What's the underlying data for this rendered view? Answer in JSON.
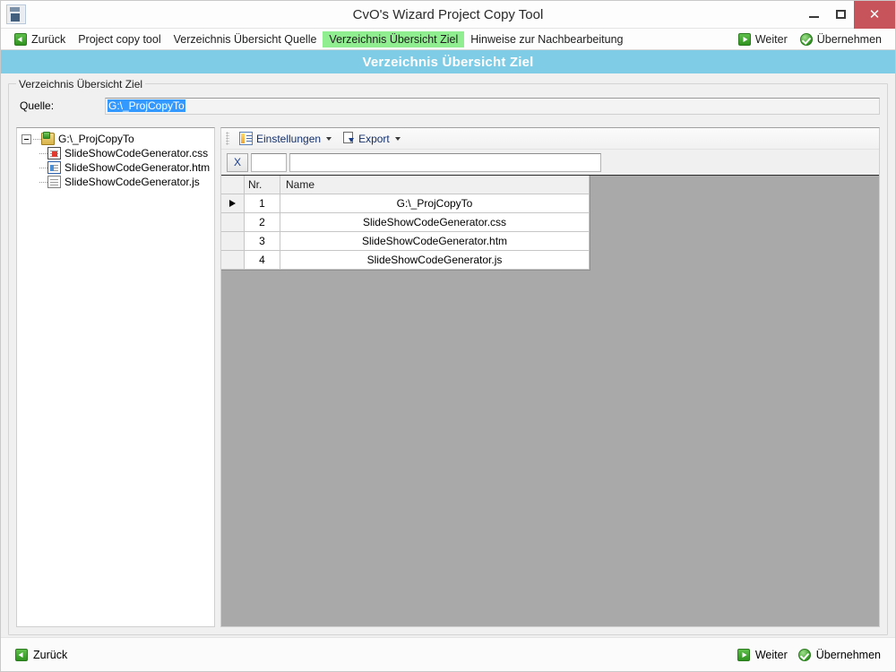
{
  "window": {
    "title": "CvO's Wizard Project Copy Tool",
    "app_icon": "app-icon",
    "controls": {
      "minimize": "minimize-icon",
      "maximize": "maximize-icon",
      "close_label": "✕"
    },
    "close_color": "#c7545a"
  },
  "navbar": {
    "back_label": "Zurück",
    "items": [
      {
        "label": "Project copy tool",
        "active": false
      },
      {
        "label": "Verzeichnis Übersicht Quelle",
        "active": false
      },
      {
        "label": "Verzeichnis Übersicht Ziel",
        "active": true
      },
      {
        "label": "Hinweise zur Nachbearbeitung",
        "active": false
      }
    ],
    "next_label": "Weiter",
    "apply_label": "Übernehmen",
    "active_color": "#90ee90"
  },
  "banner": {
    "title": "Verzeichnis Übersicht Ziel",
    "background": "#7ecce5"
  },
  "groupbox": {
    "legend": "Verzeichnis Übersicht Ziel"
  },
  "source": {
    "label": "Quelle:",
    "value": "G:\\_ProjCopyTo",
    "selected": true,
    "selection_color": "#3399ff"
  },
  "tree": {
    "root": {
      "label": "G:\\_ProjCopyTo",
      "icon": "folder-open-icon",
      "expanded": true
    },
    "children": [
      {
        "label": "SlideShowCodeGenerator.css",
        "icon": "css-file-icon"
      },
      {
        "label": "SlideShowCodeGenerator.htm",
        "icon": "htm-file-icon"
      },
      {
        "label": "SlideShowCodeGenerator.js",
        "icon": "js-file-icon"
      }
    ]
  },
  "toolstrip": {
    "settings_label": "Einstellungen",
    "settings_icon": "settings-list-icon",
    "export_label": "Export",
    "export_icon": "export-document-icon"
  },
  "filter": {
    "clear_label": "X",
    "small_value": "",
    "small_placeholder": "",
    "text_value": "",
    "text_placeholder": ""
  },
  "grid": {
    "columns": [
      "",
      "Nr.",
      "Name"
    ],
    "rows": [
      {
        "marker": true,
        "nr": "1",
        "name": "G:\\_ProjCopyTo"
      },
      {
        "marker": false,
        "nr": "2",
        "name": "SlideShowCodeGenerator.css"
      },
      {
        "marker": false,
        "nr": "3",
        "name": "SlideShowCodeGenerator.htm"
      },
      {
        "marker": false,
        "nr": "4",
        "name": "SlideShowCodeGenerator.js"
      }
    ],
    "background": "#a9a9a9"
  },
  "bottombar": {
    "back_label": "Zurück",
    "next_label": "Weiter",
    "apply_label": "Übernehmen"
  }
}
